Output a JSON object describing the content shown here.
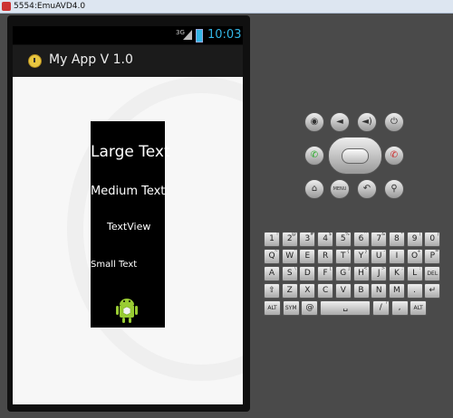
{
  "window": {
    "title": "5554:EmuAVD4.0"
  },
  "status_bar": {
    "network": "3G",
    "time": "10:03"
  },
  "action_bar": {
    "title": "My App V 1.0",
    "icon": "clock-icon"
  },
  "content": {
    "large_text": "Large Text",
    "medium_text": "Medium Text",
    "text_view": "TextView",
    "small_text": "Small Text",
    "image": "android-icon"
  },
  "controls": {
    "top_row": [
      "camera-icon",
      "volume-down-icon",
      "volume-up-icon",
      "power-icon"
    ],
    "mid_row": [
      "call-icon",
      "dpad",
      "end-call-icon"
    ],
    "bottom_row": [
      "home-icon",
      "MENU",
      "back-icon",
      "search-icon"
    ]
  },
  "keyboard": {
    "row1": [
      {
        "k": "1",
        "s": "!"
      },
      {
        "k": "2",
        "s": "@"
      },
      {
        "k": "3",
        "s": "#"
      },
      {
        "k": "4",
        "s": "$"
      },
      {
        "k": "5",
        "s": "%"
      },
      {
        "k": "6",
        "s": "^"
      },
      {
        "k": "7",
        "s": "&"
      },
      {
        "k": "8",
        "s": "*"
      },
      {
        "k": "9",
        "s": "("
      },
      {
        "k": "0",
        "s": ")"
      }
    ],
    "row2": [
      {
        "k": "Q",
        "s": "~"
      },
      {
        "k": "W",
        "s": "\""
      },
      {
        "k": "E",
        "s": ""
      },
      {
        "k": "R",
        "s": "`"
      },
      {
        "k": "T",
        "s": "{"
      },
      {
        "k": "Y",
        "s": "}"
      },
      {
        "k": "U",
        "s": "-"
      },
      {
        "k": "I",
        "s": ""
      },
      {
        "k": "O",
        "s": "+"
      },
      {
        "k": "P",
        "s": "="
      }
    ],
    "row3": [
      {
        "k": "A",
        "s": ""
      },
      {
        "k": "S",
        "s": "\\"
      },
      {
        "k": "D",
        "s": ""
      },
      {
        "k": "F",
        "s": "["
      },
      {
        "k": "G",
        "s": "]"
      },
      {
        "k": "H",
        "s": "<"
      },
      {
        "k": "J",
        "s": ">"
      },
      {
        "k": "K",
        "s": ";"
      },
      {
        "k": "L",
        "s": ":"
      },
      {
        "k": "DEL",
        "s": ""
      }
    ],
    "row4": [
      {
        "k": "⇧",
        "s": ""
      },
      {
        "k": "Z",
        "s": ""
      },
      {
        "k": "X",
        "s": ""
      },
      {
        "k": "C",
        "s": ""
      },
      {
        "k": "V",
        "s": ""
      },
      {
        "k": "B",
        "s": ""
      },
      {
        "k": "N",
        "s": ""
      },
      {
        "k": "M",
        "s": ""
      },
      {
        "k": ".",
        "s": ""
      },
      {
        "k": "↵",
        "s": ""
      }
    ],
    "row5": [
      {
        "k": "ALT",
        "s": ""
      },
      {
        "k": "SYM",
        "s": ""
      },
      {
        "k": "@",
        "s": ""
      },
      {
        "k": "␣",
        "s": ""
      },
      {
        "k": "/",
        "s": "?"
      },
      {
        "k": ",",
        "s": ""
      },
      {
        "k": "ALT",
        "s": ""
      }
    ]
  }
}
